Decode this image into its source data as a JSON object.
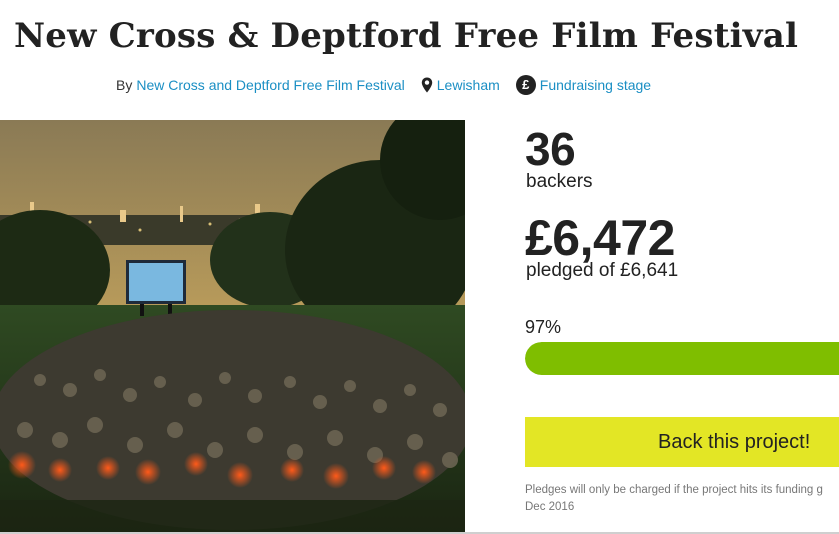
{
  "project": {
    "title": "New Cross & Deptford Free Film Festival",
    "by_label": "By",
    "creator": "New Cross and Deptford Free Film Festival",
    "location": "Lewisham",
    "stage": "Fundraising stage",
    "location_icon": "map-pin-icon",
    "stage_icon": "pound-circle-icon",
    "stage_icon_glyph": "£"
  },
  "hero_image": {
    "description_icon": "outdoor-cinema-photo"
  },
  "stats": {
    "backers_count": "36",
    "backers_label": "backers",
    "pledged_amount": "£6,472",
    "pledged_label": "pledged of £6,641",
    "percent_label": "97%",
    "percent_value": 0.97
  },
  "cta": {
    "back_label": "Back this project!"
  },
  "footnote": {
    "line1": "Pledges will only be charged if the project hits its funding g",
    "line2": "Dec 2016"
  },
  "colors": {
    "link": "#1b8fc4",
    "progress": "#7fbe00",
    "button": "#e3e625"
  }
}
